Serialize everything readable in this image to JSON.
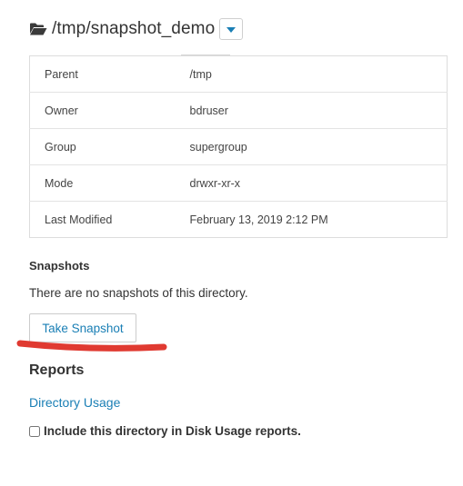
{
  "header": {
    "path": "/tmp/snapshot_demo",
    "folder_icon": "folder-open-icon",
    "dropdown_icon": "caret-down-icon",
    "accent_color": "#1a7fb5"
  },
  "properties": [
    {
      "key": "Parent",
      "value": "/tmp"
    },
    {
      "key": "Owner",
      "value": "bdruser"
    },
    {
      "key": "Group",
      "value": "supergroup"
    },
    {
      "key": "Mode",
      "value": "drwxr-xr-x"
    },
    {
      "key": "Last Modified",
      "value": "February 13, 2019 2:12 PM"
    }
  ],
  "snapshots": {
    "heading": "Snapshots",
    "empty_text": "There are no snapshots of this directory.",
    "take_snapshot_label": "Take Snapshot",
    "annotation_color": "#e03a31"
  },
  "reports": {
    "heading": "Reports",
    "directory_usage_link": "Directory Usage",
    "include_checkbox_label": "Include this directory in Disk Usage reports.",
    "include_checked": false
  }
}
